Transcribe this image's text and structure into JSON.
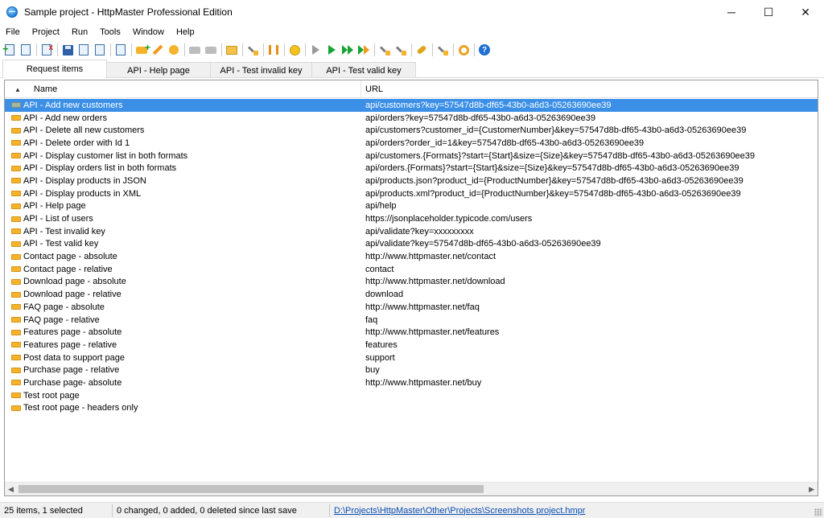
{
  "window": {
    "title": "Sample project - HttpMaster Professional Edition",
    "controls": {
      "minimize": "─",
      "maximize": "☐",
      "close": "✕"
    }
  },
  "menu": [
    "File",
    "Project",
    "Run",
    "Tools",
    "Window",
    "Help"
  ],
  "toolbar": {
    "icons": [
      "new-item-icon",
      "new-item-copy-icon",
      "delete-item-icon",
      "save-icon",
      "save-as-icon",
      "export-icon",
      "properties-icon",
      "add-tag-icon",
      "edit-tag-icon",
      "remove-tag-icon",
      "tag-left-icon",
      "tag-right-icon",
      "open-folder-icon",
      "tools-icon",
      "columns-icon",
      "smiley-icon",
      "step-icon",
      "run-icon",
      "run-all-icon",
      "run-selected-icon",
      "script-icon",
      "script-run-icon",
      "key-icon",
      "parameters-icon",
      "settings-icon",
      "help-icon"
    ]
  },
  "tabs": [
    {
      "label": "Request items",
      "active": true
    },
    {
      "label": "API - Help page",
      "active": false
    },
    {
      "label": "API - Test invalid key",
      "active": false
    },
    {
      "label": "API - Test valid key",
      "active": false
    }
  ],
  "grid": {
    "columns": {
      "name": "Name",
      "url": "URL",
      "sort_indicator": "▲"
    },
    "rows": [
      {
        "name": "API - Add new customers",
        "url": "api/customers?key=57547d8b-df65-43b0-a6d3-05263690ee39",
        "selected": true
      },
      {
        "name": "API - Add new orders",
        "url": "api/orders?key=57547d8b-df65-43b0-a6d3-05263690ee39"
      },
      {
        "name": "API - Delete all new customers",
        "url": "api/customers?customer_id={CustomerNumber}&key=57547d8b-df65-43b0-a6d3-05263690ee39"
      },
      {
        "name": "API - Delete order with Id 1",
        "url": "api/orders?order_id=1&key=57547d8b-df65-43b0-a6d3-05263690ee39"
      },
      {
        "name": "API - Display customer list in both formats",
        "url": "api/customers.{Formats}?start={Start}&size={Size}&key=57547d8b-df65-43b0-a6d3-05263690ee39"
      },
      {
        "name": "API - Display orders list in both formats",
        "url": "api/orders.{Formats}?start={Start}&size={Size}&key=57547d8b-df65-43b0-a6d3-05263690ee39"
      },
      {
        "name": "API - Display products in JSON",
        "url": "api/products.json?product_id={ProductNumber}&key=57547d8b-df65-43b0-a6d3-05263690ee39"
      },
      {
        "name": "API - Display products in XML",
        "url": "api/products.xml?product_id={ProductNumber}&key=57547d8b-df65-43b0-a6d3-05263690ee39"
      },
      {
        "name": "API - Help page",
        "url": "api/help"
      },
      {
        "name": "API - List of users",
        "url": "https://jsonplaceholder.typicode.com/users"
      },
      {
        "name": "API - Test invalid key",
        "url": "api/validate?key=xxxxxxxxx"
      },
      {
        "name": "API - Test valid key",
        "url": "api/validate?key=57547d8b-df65-43b0-a6d3-05263690ee39"
      },
      {
        "name": "Contact page - absolute",
        "url": "http://www.httpmaster.net/contact"
      },
      {
        "name": "Contact page - relative",
        "url": "contact"
      },
      {
        "name": "Download page - absolute",
        "url": "http://www.httpmaster.net/download"
      },
      {
        "name": "Download page - relative",
        "url": "download"
      },
      {
        "name": "FAQ page - absolute",
        "url": "http://www.httpmaster.net/faq"
      },
      {
        "name": "FAQ page - relative",
        "url": "faq"
      },
      {
        "name": "Features page - absolute",
        "url": "http://www.httpmaster.net/features"
      },
      {
        "name": "Features page - relative",
        "url": "features"
      },
      {
        "name": "Post data to support page",
        "url": "support"
      },
      {
        "name": "Purchase page - relative",
        "url": "buy"
      },
      {
        "name": "Purchase page- absolute",
        "url": "http://www.httpmaster.net/buy"
      },
      {
        "name": "Test root page",
        "url": ""
      },
      {
        "name": "Test root page - headers only",
        "url": ""
      }
    ]
  },
  "statusbar": {
    "count": "25 items, 1 selected",
    "changes": "0 changed, 0 added, 0 deleted since last save",
    "path": "D:\\Projects\\HttpMaster\\Other\\Projects\\Screenshots project.hmpr"
  },
  "colors": {
    "selection": "#3b8fe6",
    "item_icon": "#f5b32c",
    "link": "#0a4db3"
  }
}
